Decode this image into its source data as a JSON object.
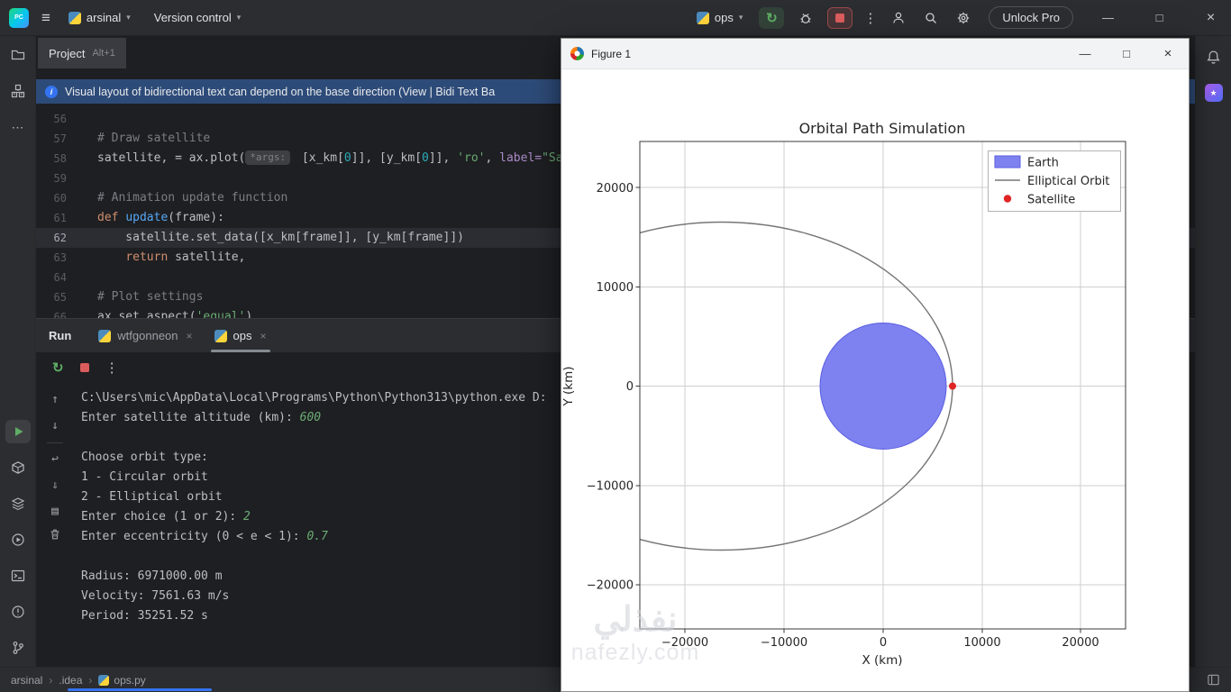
{
  "glyphs": {
    "pc": "PC",
    "hamburger": "≡",
    "chevron": "▾",
    "more_v": "⋮",
    "more_h": "⋯",
    "minimize": "—",
    "maximize": "□",
    "close": "×",
    "rerun": "↻",
    "up": "↑",
    "down": "↓",
    "wrap": "↩",
    "scroll_end": "⇓",
    "print": "▤",
    "sep": "›",
    "star": "★",
    "info": "i"
  },
  "titlebar": {
    "project_name": "arsinal",
    "vcs_label": "Version control",
    "run_config": "ops",
    "unlock_label": "Unlock Pro"
  },
  "project_tool_tab": {
    "label": "Project",
    "shortcut": "Alt+1"
  },
  "banner": {
    "text": "Visual layout of bidirectional text can depend on the base direction (View | Bidi Text Ba"
  },
  "editor": {
    "lines": [
      {
        "num": "56",
        "tokens": []
      },
      {
        "num": "57",
        "tokens": [
          {
            "t": "# Draw satellite",
            "c": "comment"
          }
        ]
      },
      {
        "num": "58",
        "tokens": [
          {
            "t": "satellite, = ax.plot(",
            "c": "plain"
          },
          {
            "t": "*args:",
            "c": "hint"
          },
          {
            "t": " [x_km[",
            "c": "plain"
          },
          {
            "t": "0",
            "c": "number"
          },
          {
            "t": "]], [y_km[",
            "c": "plain"
          },
          {
            "t": "0",
            "c": "number"
          },
          {
            "t": "]], ",
            "c": "plain"
          },
          {
            "t": "'ro'",
            "c": "string"
          },
          {
            "t": ", ",
            "c": "plain"
          },
          {
            "t": "label=",
            "c": "namedarg"
          },
          {
            "t": "\"Sa",
            "c": "string"
          }
        ]
      },
      {
        "num": "59",
        "tokens": []
      },
      {
        "num": "60",
        "tokens": [
          {
            "t": "# Animation update function",
            "c": "comment"
          }
        ]
      },
      {
        "num": "61",
        "tokens": [
          {
            "t": "def ",
            "c": "keyword"
          },
          {
            "t": "update",
            "c": "func"
          },
          {
            "t": "(frame):",
            "c": "plain"
          }
        ]
      },
      {
        "num": "62",
        "current": true,
        "tokens": [
          {
            "t": "    satellite.set_data([x_km[frame]], [y_km[frame]])",
            "c": "plain"
          }
        ]
      },
      {
        "num": "63",
        "tokens": [
          {
            "t": "    ",
            "c": "plain"
          },
          {
            "t": "return",
            "c": "keyword"
          },
          {
            "t": " satellite,",
            "c": "plain"
          }
        ]
      },
      {
        "num": "64",
        "tokens": []
      },
      {
        "num": "65",
        "tokens": [
          {
            "t": "# Plot settings",
            "c": "comment"
          }
        ]
      },
      {
        "num": "66",
        "tokens": [
          {
            "t": "ax.set_aspect(",
            "c": "plain"
          },
          {
            "t": "'equal'",
            "c": "string"
          },
          {
            "t": ")",
            "c": "plain"
          }
        ]
      }
    ]
  },
  "run_panel": {
    "title": "Run",
    "tabs": [
      {
        "label": "wtfgonneon"
      },
      {
        "label": "ops"
      }
    ],
    "console": [
      [
        {
          "t": "C:\\Users\\mic\\AppData\\Local\\Programs\\Python\\Python313\\python.exe D:",
          "c": "out"
        }
      ],
      [
        {
          "t": "Enter satellite altitude (km): ",
          "c": "out"
        },
        {
          "t": "600",
          "c": "input"
        }
      ],
      [],
      [
        {
          "t": "Choose orbit type:",
          "c": "out"
        }
      ],
      [
        {
          "t": "1 - Circular orbit",
          "c": "out"
        }
      ],
      [
        {
          "t": "2 - Elliptical orbit",
          "c": "out"
        }
      ],
      [
        {
          "t": "Enter choice (1 or 2): ",
          "c": "out"
        },
        {
          "t": "2",
          "c": "input"
        }
      ],
      [
        {
          "t": "Enter eccentricity (0 < e < 1): ",
          "c": "out"
        },
        {
          "t": "0.7",
          "c": "input"
        }
      ],
      [],
      [
        {
          "t": "Radius: 6971000.00 m",
          "c": "out"
        }
      ],
      [
        {
          "t": "Velocity: 7561.63 m/s",
          "c": "out"
        }
      ],
      [
        {
          "t": "Period: 35251.52 s",
          "c": "out"
        }
      ]
    ]
  },
  "statusbar": {
    "breadcrumb": [
      "arsinal",
      ".idea",
      "ops.py"
    ]
  },
  "figure": {
    "title": "Figure 1",
    "chart_data": {
      "type": "line",
      "title": "Orbital Path Simulation",
      "xlabel": "X (km)",
      "ylabel": "Y (km)",
      "xticks": [
        "−20000",
        "−10000",
        "0",
        "10000",
        "20000"
      ],
      "yticks": [
        "20000",
        "10000",
        "0",
        "−10000",
        "−20000"
      ],
      "xlim_km": [
        -24500,
        24500
      ],
      "ylim_km": [
        -24600,
        24700
      ],
      "grid": true,
      "legend_position": "upper right",
      "legend": [
        {
          "label": "Earth",
          "marker": "patch",
          "color": "#7e82f0"
        },
        {
          "label": "Elliptical Orbit",
          "marker": "line",
          "color": "#757575"
        },
        {
          "label": "Satellite",
          "marker": "dot",
          "color": "#e02424"
        }
      ],
      "earth": {
        "center_km": [
          0,
          0
        ],
        "radius_km": 6371
      },
      "orbit": {
        "type": "elliptical",
        "eccentricity": 0.7,
        "perigee_radius_km": 6971,
        "semi_major_axis_km": 23237,
        "semi_minor_axis_km": 16594,
        "center_km": [
          -16266,
          0
        ]
      },
      "satellite_position_km": [
        6971,
        0
      ]
    }
  },
  "watermark": {
    "arabic": "نفذلي",
    "latin": "nafezly.com"
  },
  "colors": {
    "accent_blue": "#3574f0",
    "run_green": "#5fad65",
    "stop_red": "#db5c5c",
    "banner_bg": "#2d4b78",
    "earth_fill": "#7e82f0",
    "orbit_gray": "#757575",
    "satellite_red": "#e02424"
  }
}
